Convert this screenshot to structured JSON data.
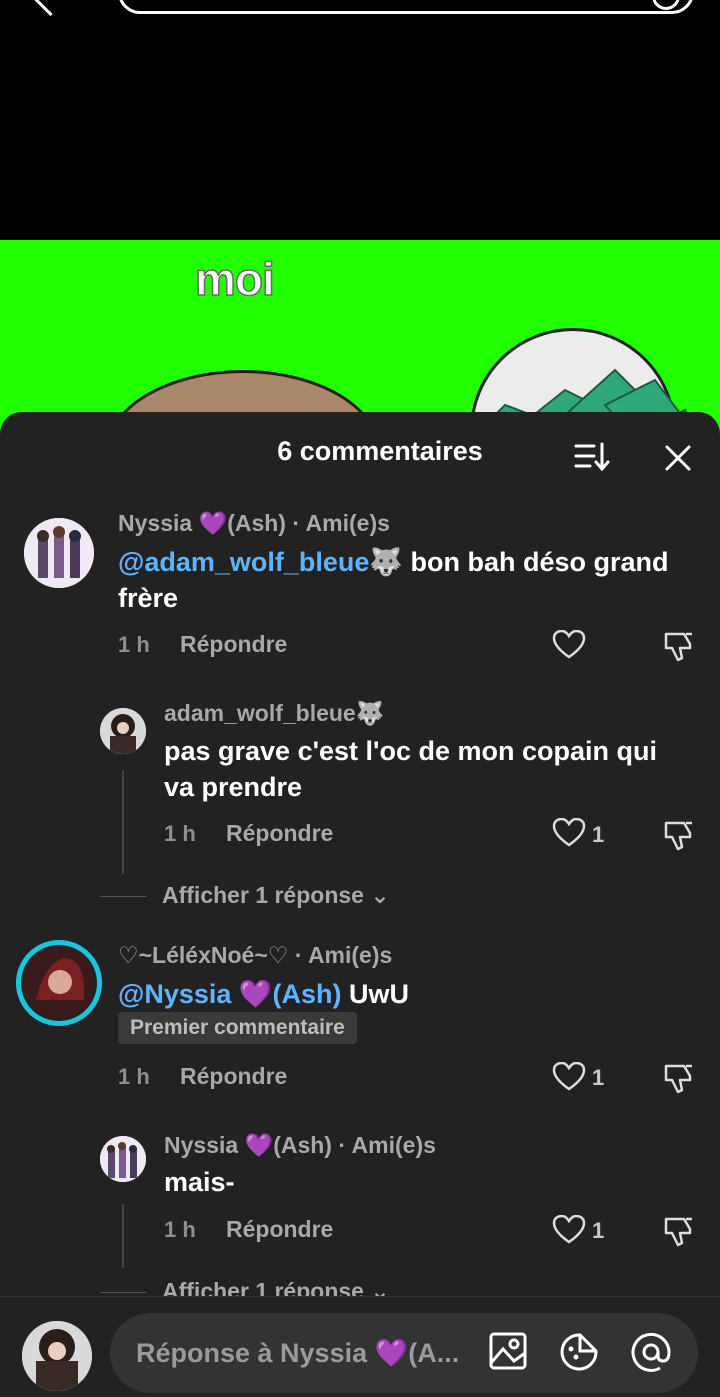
{
  "header": {
    "back_icon": "chevron-left-icon",
    "search_icon": "search-icon"
  },
  "video": {
    "caption": "moi",
    "background": "#22ff00"
  },
  "sheet": {
    "title": "6 commentaires",
    "sort_icon": "sort-icon",
    "close_icon": "close-icon"
  },
  "comments": [
    {
      "author": "Nyssia 💜(Ash) · Ami(e)s",
      "mention": "@adam_wolf_bleue🐺",
      "text_line1": " bon bah déso grand",
      "text_line2": "frère",
      "time": "1 h",
      "reply_label": "Répondre",
      "likes": ""
    },
    {
      "author": "adam_wolf_bleue🐺",
      "text_line1": "pas grave c'est l'oc de mon copain qui",
      "text_line2": "va prendre",
      "time": "1 h",
      "reply_label": "Répondre",
      "likes": "1"
    },
    {
      "author": "♡~LéléxNoé~♡ · Ami(e)s",
      "mention": "@Nyssia 💜(Ash)",
      "text": " UwU",
      "badge": "Premier commentaire",
      "time": "1 h",
      "reply_label": "Répondre",
      "likes": "1"
    },
    {
      "author": "Nyssia 💜(Ash) · Ami(e)s",
      "text": "mais-",
      "time": "1 h",
      "reply_label": "Répondre",
      "likes": "1"
    }
  ],
  "more_replies": [
    "Afficher 1 réponse",
    "Afficher 1 réponse"
  ],
  "composer": {
    "placeholder": "Réponse à Nyssia 💜(A...",
    "icons": [
      "image-icon",
      "sticker-icon",
      "at-mention-icon"
    ]
  }
}
